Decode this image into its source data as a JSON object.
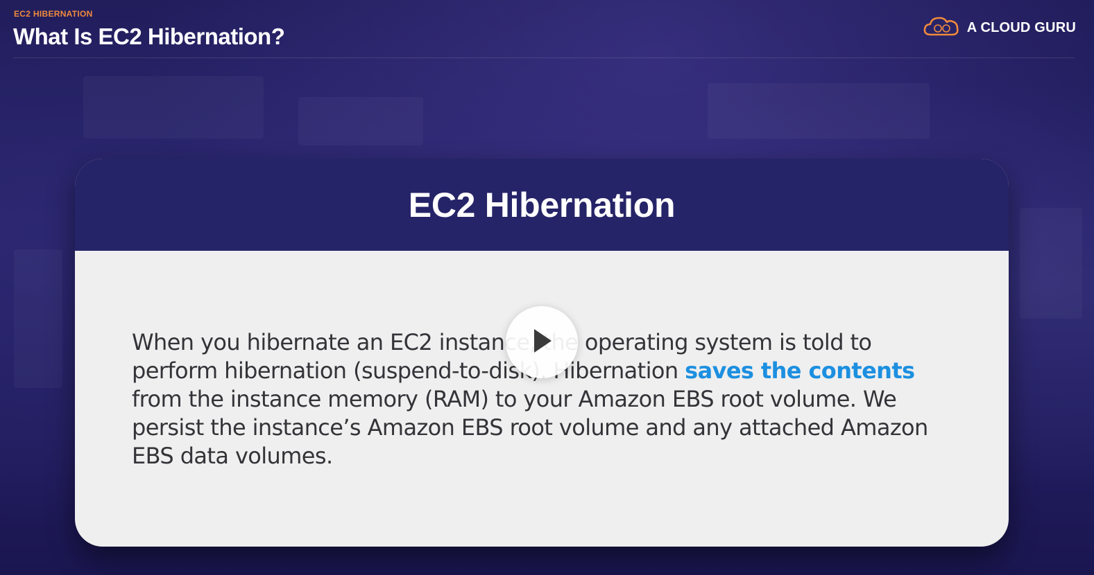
{
  "header": {
    "eyebrow": "EC2 HIBERNATION",
    "title": "What Is EC2 Hibernation?"
  },
  "brand": {
    "name": "A CLOUD GURU",
    "icon": "cloud-logo-icon",
    "accent_color": "#f08a3c"
  },
  "card": {
    "title": "EC2 Hibernation",
    "body_before": "When you hibernate an EC2 instance, the operating system is told to perform hibernation (suspend-to-disk). Hibernation ",
    "body_highlight": "saves the contents",
    "body_after": " from the instance memory (RAM) to your Amazon EBS root volume. We persist the instance’s Amazon EBS root volume and any attached Amazon EBS data volumes.",
    "header_color": "#262468",
    "highlight_color": "#1c8fe0"
  },
  "player": {
    "play_icon": "play-icon"
  }
}
